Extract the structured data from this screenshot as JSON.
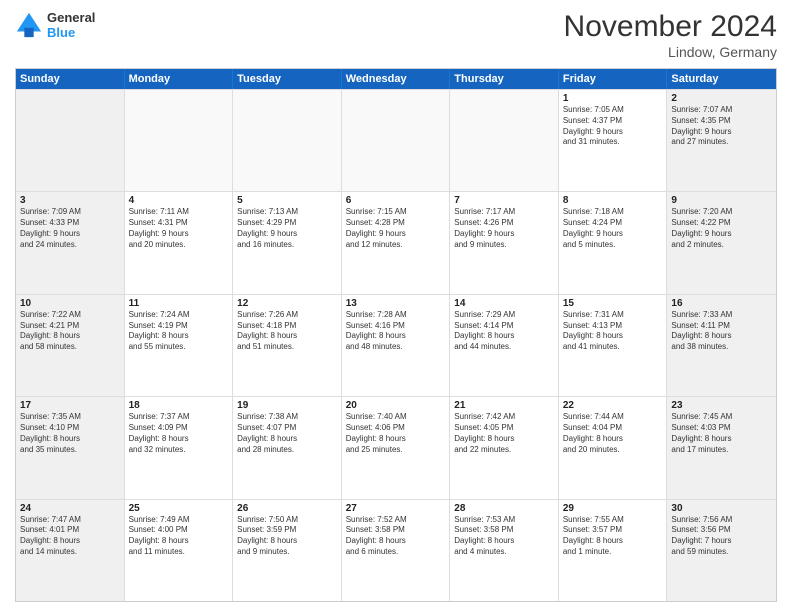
{
  "logo": {
    "line1": "General",
    "line2": "Blue"
  },
  "title": "November 2024",
  "location": "Lindow, Germany",
  "header": {
    "days": [
      "Sunday",
      "Monday",
      "Tuesday",
      "Wednesday",
      "Thursday",
      "Friday",
      "Saturday"
    ]
  },
  "weeks": [
    [
      {
        "day": "",
        "text": ""
      },
      {
        "day": "",
        "text": ""
      },
      {
        "day": "",
        "text": ""
      },
      {
        "day": "",
        "text": ""
      },
      {
        "day": "",
        "text": ""
      },
      {
        "day": "1",
        "text": "Sunrise: 7:05 AM\nSunset: 4:37 PM\nDaylight: 9 hours\nand 31 minutes."
      },
      {
        "day": "2",
        "text": "Sunrise: 7:07 AM\nSunset: 4:35 PM\nDaylight: 9 hours\nand 27 minutes."
      }
    ],
    [
      {
        "day": "3",
        "text": "Sunrise: 7:09 AM\nSunset: 4:33 PM\nDaylight: 9 hours\nand 24 minutes."
      },
      {
        "day": "4",
        "text": "Sunrise: 7:11 AM\nSunset: 4:31 PM\nDaylight: 9 hours\nand 20 minutes."
      },
      {
        "day": "5",
        "text": "Sunrise: 7:13 AM\nSunset: 4:29 PM\nDaylight: 9 hours\nand 16 minutes."
      },
      {
        "day": "6",
        "text": "Sunrise: 7:15 AM\nSunset: 4:28 PM\nDaylight: 9 hours\nand 12 minutes."
      },
      {
        "day": "7",
        "text": "Sunrise: 7:17 AM\nSunset: 4:26 PM\nDaylight: 9 hours\nand 9 minutes."
      },
      {
        "day": "8",
        "text": "Sunrise: 7:18 AM\nSunset: 4:24 PM\nDaylight: 9 hours\nand 5 minutes."
      },
      {
        "day": "9",
        "text": "Sunrise: 7:20 AM\nSunset: 4:22 PM\nDaylight: 9 hours\nand 2 minutes."
      }
    ],
    [
      {
        "day": "10",
        "text": "Sunrise: 7:22 AM\nSunset: 4:21 PM\nDaylight: 8 hours\nand 58 minutes."
      },
      {
        "day": "11",
        "text": "Sunrise: 7:24 AM\nSunset: 4:19 PM\nDaylight: 8 hours\nand 55 minutes."
      },
      {
        "day": "12",
        "text": "Sunrise: 7:26 AM\nSunset: 4:18 PM\nDaylight: 8 hours\nand 51 minutes."
      },
      {
        "day": "13",
        "text": "Sunrise: 7:28 AM\nSunset: 4:16 PM\nDaylight: 8 hours\nand 48 minutes."
      },
      {
        "day": "14",
        "text": "Sunrise: 7:29 AM\nSunset: 4:14 PM\nDaylight: 8 hours\nand 44 minutes."
      },
      {
        "day": "15",
        "text": "Sunrise: 7:31 AM\nSunset: 4:13 PM\nDaylight: 8 hours\nand 41 minutes."
      },
      {
        "day": "16",
        "text": "Sunrise: 7:33 AM\nSunset: 4:11 PM\nDaylight: 8 hours\nand 38 minutes."
      }
    ],
    [
      {
        "day": "17",
        "text": "Sunrise: 7:35 AM\nSunset: 4:10 PM\nDaylight: 8 hours\nand 35 minutes."
      },
      {
        "day": "18",
        "text": "Sunrise: 7:37 AM\nSunset: 4:09 PM\nDaylight: 8 hours\nand 32 minutes."
      },
      {
        "day": "19",
        "text": "Sunrise: 7:38 AM\nSunset: 4:07 PM\nDaylight: 8 hours\nand 28 minutes."
      },
      {
        "day": "20",
        "text": "Sunrise: 7:40 AM\nSunset: 4:06 PM\nDaylight: 8 hours\nand 25 minutes."
      },
      {
        "day": "21",
        "text": "Sunrise: 7:42 AM\nSunset: 4:05 PM\nDaylight: 8 hours\nand 22 minutes."
      },
      {
        "day": "22",
        "text": "Sunrise: 7:44 AM\nSunset: 4:04 PM\nDaylight: 8 hours\nand 20 minutes."
      },
      {
        "day": "23",
        "text": "Sunrise: 7:45 AM\nSunset: 4:03 PM\nDaylight: 8 hours\nand 17 minutes."
      }
    ],
    [
      {
        "day": "24",
        "text": "Sunrise: 7:47 AM\nSunset: 4:01 PM\nDaylight: 8 hours\nand 14 minutes."
      },
      {
        "day": "25",
        "text": "Sunrise: 7:49 AM\nSunset: 4:00 PM\nDaylight: 8 hours\nand 11 minutes."
      },
      {
        "day": "26",
        "text": "Sunrise: 7:50 AM\nSunset: 3:59 PM\nDaylight: 8 hours\nand 9 minutes."
      },
      {
        "day": "27",
        "text": "Sunrise: 7:52 AM\nSunset: 3:58 PM\nDaylight: 8 hours\nand 6 minutes."
      },
      {
        "day": "28",
        "text": "Sunrise: 7:53 AM\nSunset: 3:58 PM\nDaylight: 8 hours\nand 4 minutes."
      },
      {
        "day": "29",
        "text": "Sunrise: 7:55 AM\nSunset: 3:57 PM\nDaylight: 8 hours\nand 1 minute."
      },
      {
        "day": "30",
        "text": "Sunrise: 7:56 AM\nSunset: 3:56 PM\nDaylight: 7 hours\nand 59 minutes."
      }
    ]
  ]
}
